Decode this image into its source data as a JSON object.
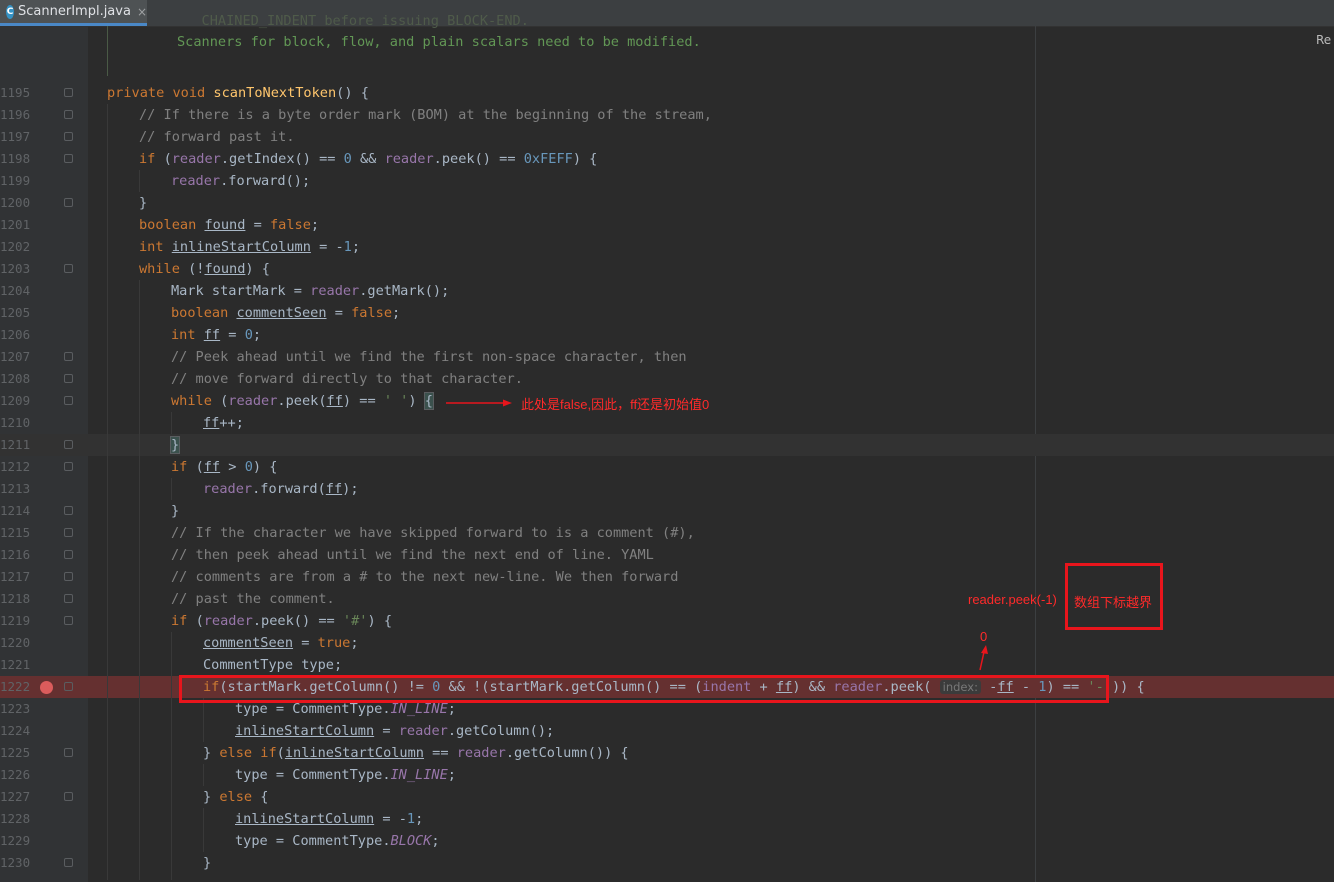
{
  "tab": {
    "label": "ScannerImpl.java",
    "icon": "class-icon",
    "close": "×"
  },
  "right_edge_label": "Re",
  "doc_lines": [
    "   CHAINED_INDENT before issuing BLOCK-END.",
    "Scanners for block, flow, and plain scalars need to be modified."
  ],
  "line_numbers": [
    "1195",
    "1196",
    "1197",
    "1198",
    "1199",
    "1200",
    "1201",
    "1202",
    "1203",
    "1204",
    "1205",
    "1206",
    "1207",
    "1208",
    "1209",
    "1210",
    "1211",
    "1212",
    "1213",
    "1214",
    "1215",
    "1216",
    "1217",
    "1218",
    "1219",
    "1220",
    "1221",
    "1222",
    "1223",
    "1224",
    "1225",
    "1226",
    "1227",
    "1228",
    "1229",
    "1230"
  ],
  "annotations": {
    "arrow_note": "此处是false,因此，ff还是初始值0",
    "peek_note": "reader.peek(-1)",
    "boxed_note": "数组下标越界",
    "zero_note": "0"
  },
  "inlay_hint": "index:",
  "colors": {
    "annotation_red": "#e8151c",
    "breakpoint_row": "#653030",
    "keyword": "#cc7832"
  }
}
